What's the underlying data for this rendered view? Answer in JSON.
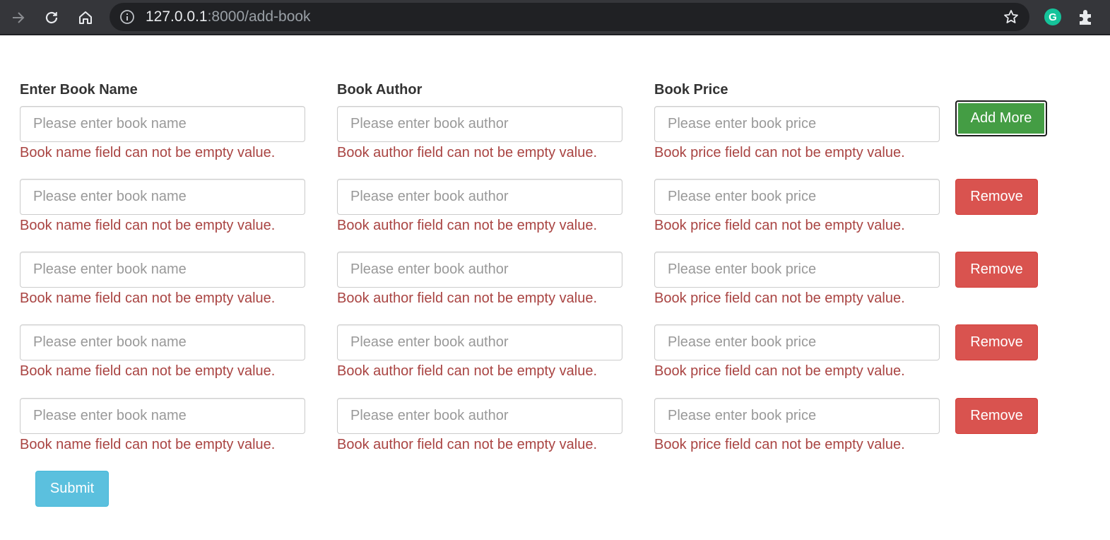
{
  "browser": {
    "url_host": "127.0.0.1",
    "url_rest": ":8000/add-book",
    "grammarly_letter": "G"
  },
  "form": {
    "labels": {
      "name": "Enter Book Name",
      "author": "Book Author",
      "price": "Book Price"
    },
    "placeholders": {
      "name": "Please enter book name",
      "author": "Please enter book author",
      "price": "Please enter book price"
    },
    "errors": {
      "name": "Book name field can not be empty value.",
      "author": "Book author field can not be empty value.",
      "price": "Book price field can not be empty value."
    },
    "add_more_label": "Add More",
    "remove_label": "Remove",
    "submit_label": "Submit"
  },
  "colors": {
    "error": "#a94442",
    "add_button": "#449d44",
    "remove_button": "#d9534f",
    "submit_button": "#5bc0de"
  }
}
